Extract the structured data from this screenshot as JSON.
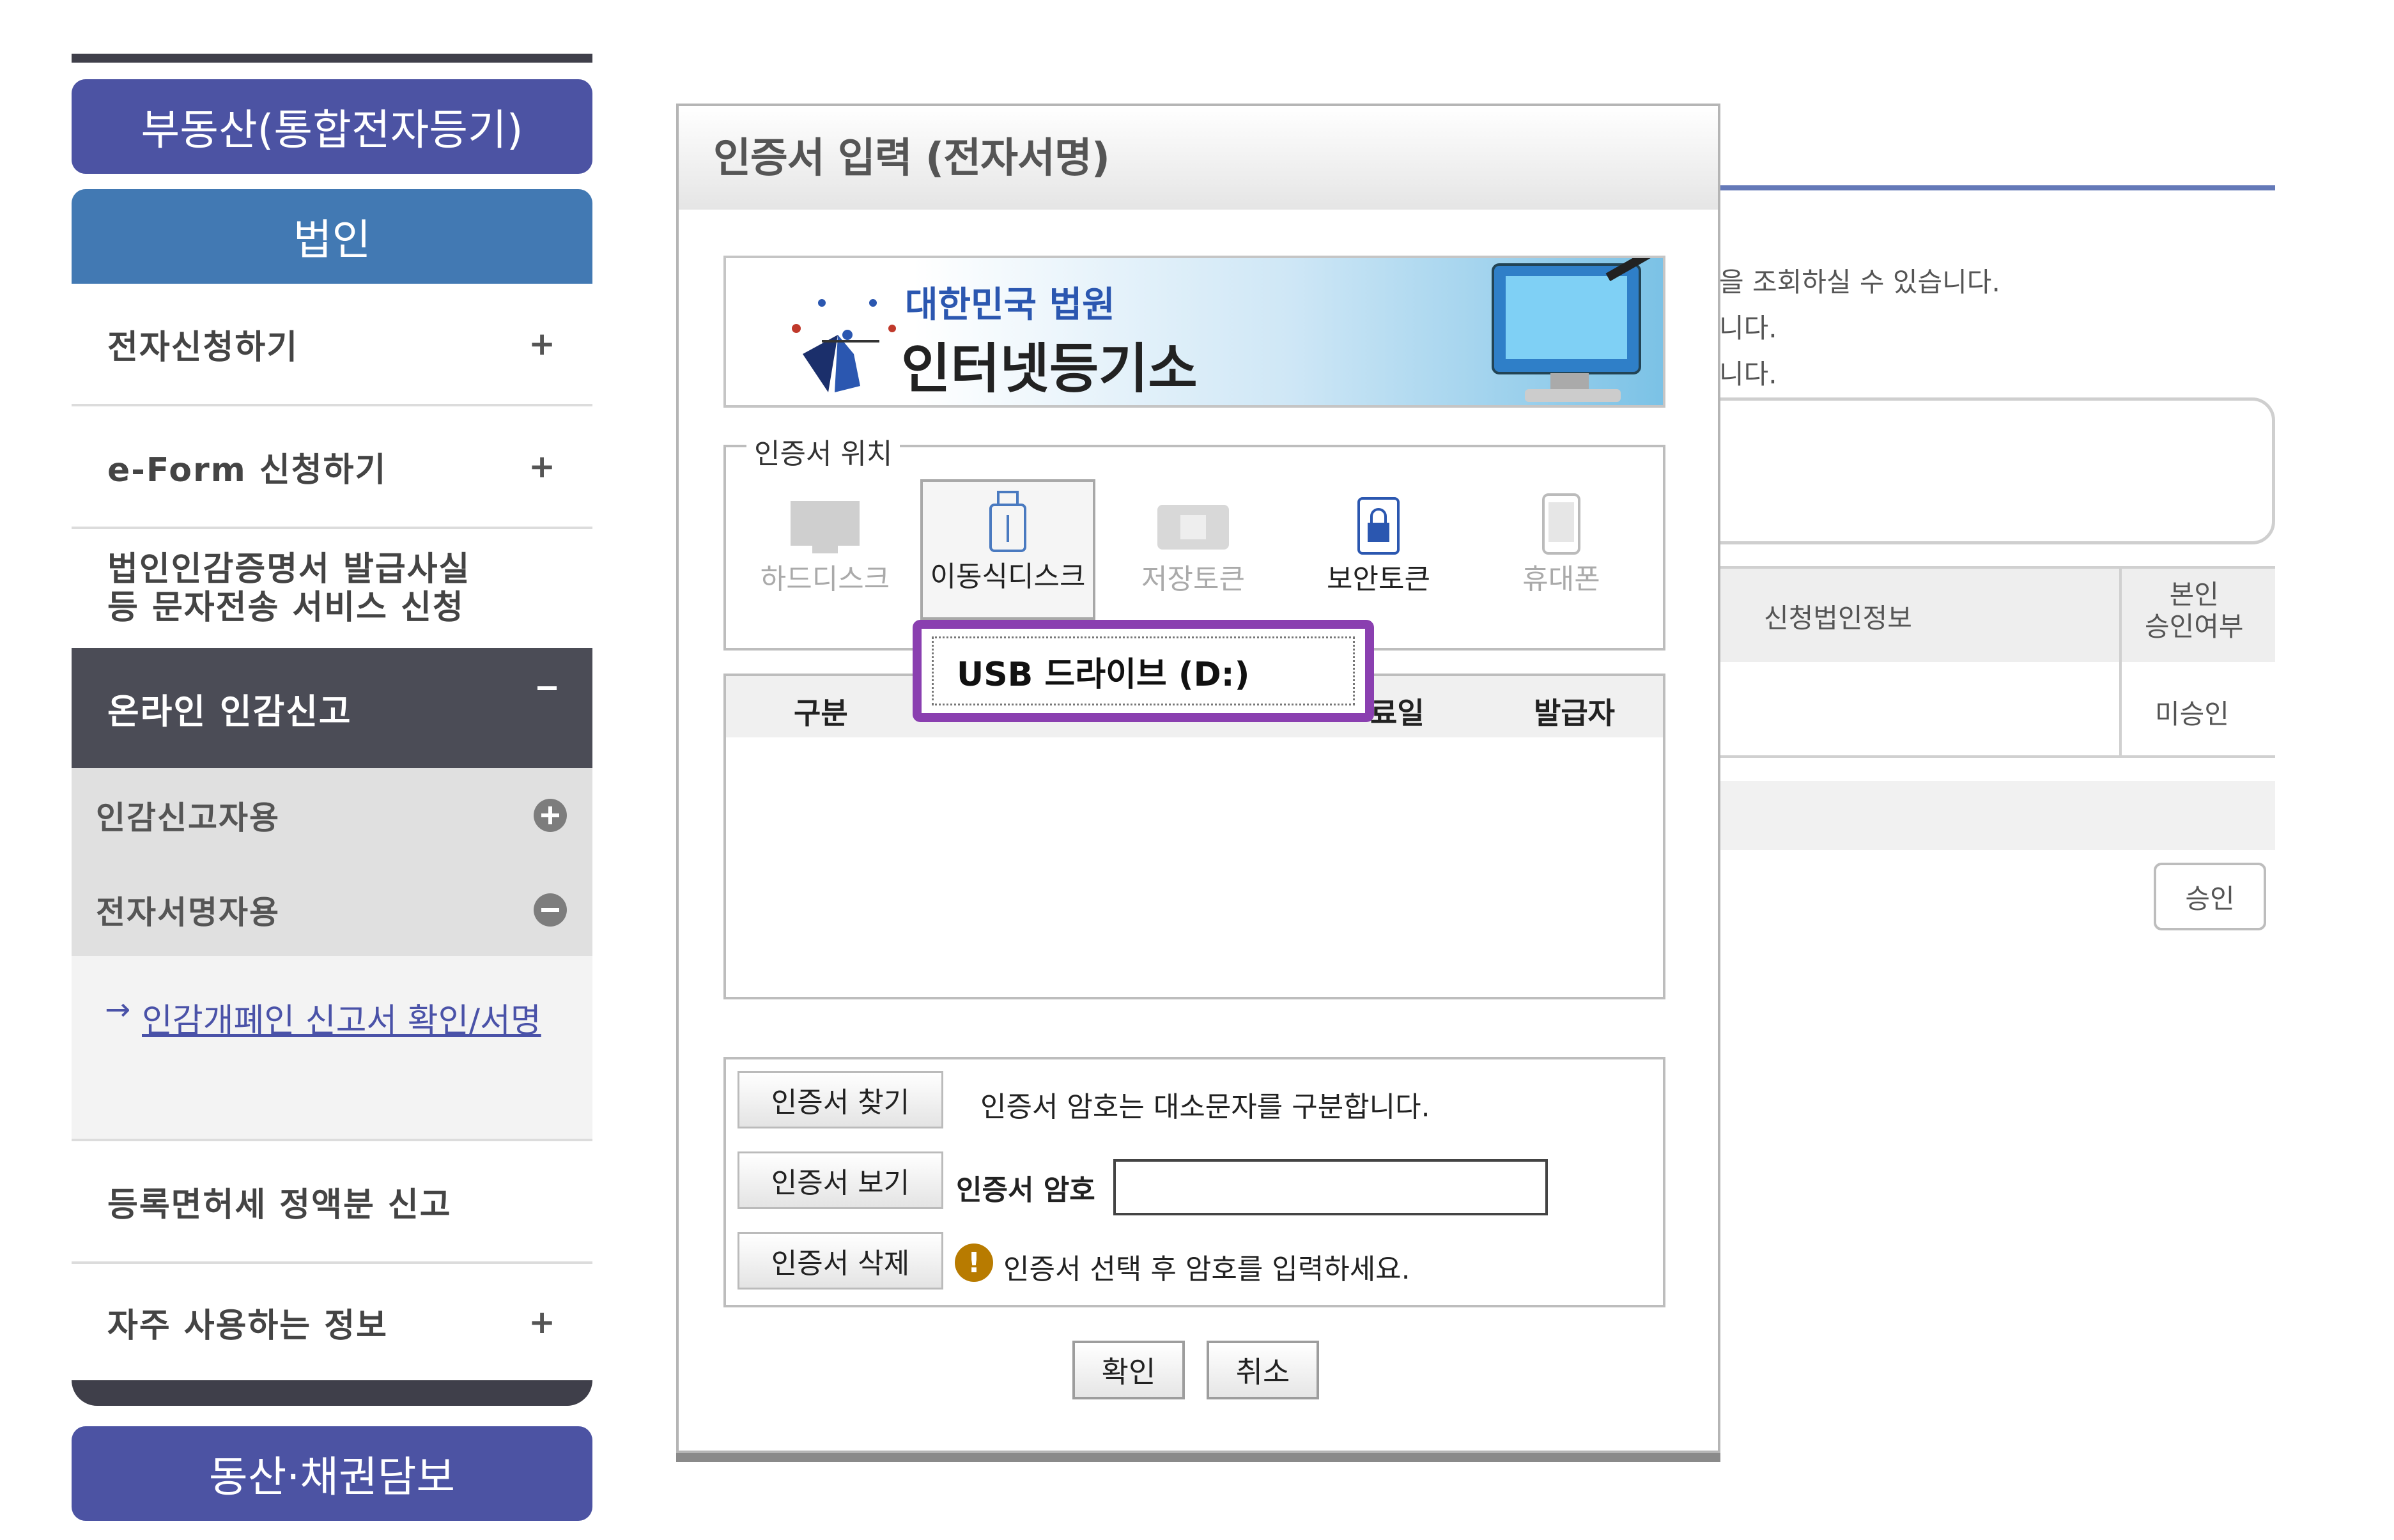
{
  "sidebar": {
    "realestate": "부동산(통합전자등기)",
    "corporation": "법인",
    "items": [
      {
        "label": "전자신청하기",
        "marker": "+"
      },
      {
        "label": "e-Form 신청하기",
        "marker": "+"
      },
      {
        "label": "법인인감증명서 발급사실\n등 문자전송 서비스 신청"
      }
    ],
    "online_seal": "온라인 인감신고",
    "sub_items": [
      "인감신고자용",
      "전자서명자용"
    ],
    "link_label": "인감개폐인 신고서 확인/서명",
    "tax": "등록면허세 정액분 신고",
    "faq": {
      "label": "자주 사용하는 정보",
      "marker": "+"
    },
    "movables": "동산·채권담보"
  },
  "background": {
    "lines": [
      "을 조회하실 수 있습니다.",
      "니다.",
      "니다."
    ],
    "col_info": "신청법인정보",
    "col_approve": "본인\n승인여부",
    "row_status": "미승인",
    "approve_btn": "승인"
  },
  "dialog": {
    "title": "인증서 입력 (전자서명)",
    "banner": {
      "line1": "대한민국 법원",
      "line2": "인터넷등기소"
    },
    "location_label": "인증서 위치",
    "locations": [
      "하드디스크",
      "이동식디스크",
      "저장토큰",
      "보안토큰",
      "휴대폰"
    ],
    "usb_drive": "USB 드라이브 (D:)",
    "columns": [
      "구분",
      "료일",
      "발급자"
    ],
    "buttons": {
      "find": "인증서 찾기",
      "view": "인증서 보기",
      "delete": "인증서 삭제"
    },
    "case_note": "인증서 암호는 대소문자를 구분합니다.",
    "pw_label": "인증서 암호",
    "pw_value": "",
    "warn_note": "인증서 선택 후 암호를 입력하세요.",
    "ok": "확인",
    "cancel": "취소"
  },
  "colors": {
    "accent_purple": "#8a3fb0",
    "nav_blue": "#4c53a3",
    "corp_blue": "#4279b3",
    "dark_menu": "#4b4c56"
  }
}
